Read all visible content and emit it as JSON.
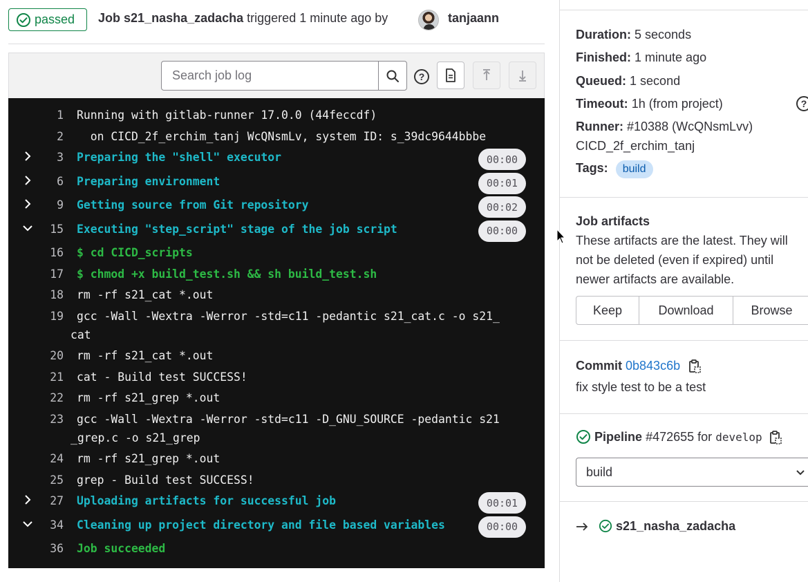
{
  "header": {
    "status_label": "passed",
    "job_prefix": "Job",
    "job_name": "s21_nasha_zadacha",
    "triggered_text": "triggered 1 minute ago by",
    "author": "tanjaann"
  },
  "toolbar": {
    "search_placeholder": "Search job log"
  },
  "log": {
    "lines": [
      {
        "n": "1",
        "text": "Running with gitlab-runner 17.0.0 (44feccdf)",
        "kind": "plain"
      },
      {
        "n": "2",
        "text": "  on CICD_2f_erchim_tanj WcQNsmLv, system ID: s_39dc9644bbbe",
        "kind": "plain"
      },
      {
        "n": "3",
        "text": "Preparing the \"shell\" executor",
        "kind": "section",
        "collapsed": true,
        "duration": "00:00"
      },
      {
        "n": "6",
        "text": "Preparing environment",
        "kind": "section",
        "collapsed": true,
        "duration": "00:01"
      },
      {
        "n": "9",
        "text": "Getting source from Git repository",
        "kind": "section",
        "collapsed": true,
        "duration": "00:02"
      },
      {
        "n": "15",
        "text": "Executing \"step_script\" stage of the job script",
        "kind": "section",
        "collapsed": false,
        "duration": "00:00"
      },
      {
        "n": "16",
        "text": "$ cd CICD_scripts",
        "kind": "command"
      },
      {
        "n": "17",
        "text": "$ chmod +x build_test.sh && sh build_test.sh",
        "kind": "command"
      },
      {
        "n": "18",
        "text": "rm -rf s21_cat *.out",
        "kind": "plain"
      },
      {
        "n": "19",
        "text": "gcc -Wall -Wextra -Werror -std=c11 -pedantic s21_cat.c -o s21_",
        "cont": "cat",
        "kind": "plain"
      },
      {
        "n": "20",
        "text": "rm -rf s21_cat *.out",
        "kind": "plain"
      },
      {
        "n": "21",
        "text": "cat - Build test SUCCESS!",
        "kind": "plain"
      },
      {
        "n": "22",
        "text": "rm -rf s21_grep *.out",
        "kind": "plain"
      },
      {
        "n": "23",
        "text": "gcc -Wall -Wextra -Werror -std=c11 -D_GNU_SOURCE -pedantic s21",
        "cont": "_grep.c -o s21_grep",
        "kind": "plain"
      },
      {
        "n": "24",
        "text": "rm -rf s21_grep *.out",
        "kind": "plain"
      },
      {
        "n": "25",
        "text": "grep - Build test SUCCESS!",
        "kind": "plain"
      },
      {
        "n": "27",
        "text": "Uploading artifacts for successful job",
        "kind": "section",
        "collapsed": true,
        "duration": "00:01"
      },
      {
        "n": "34",
        "text": "Cleaning up project directory and file based variables",
        "kind": "section",
        "collapsed": false,
        "duration": "00:00"
      },
      {
        "n": "36",
        "text": "Job succeeded",
        "kind": "success"
      }
    ]
  },
  "sidebar": {
    "duration_label": "Duration:",
    "duration_value": "5 seconds",
    "finished_label": "Finished:",
    "finished_value": "1 minute ago",
    "queued_label": "Queued:",
    "queued_value": "1 second",
    "timeout_label": "Timeout:",
    "timeout_value": "1h (from project)",
    "runner_label": "Runner:",
    "runner_value": "#10388 (WcQNsmLvv)",
    "runner_name": "CICD_2f_erchim_tanj",
    "tags_label": "Tags:",
    "tag": "build",
    "artifacts_title": "Job artifacts",
    "artifacts_desc": "These artifacts are the latest. They will not be deleted (even if expired) until newer artifacts are available.",
    "keep_label": "Keep",
    "download_label": "Download",
    "browse_label": "Browse",
    "commit_label": "Commit",
    "commit_sha": "0b843c6b",
    "commit_message": "fix style test to be a test",
    "pipeline_label": "Pipeline",
    "pipeline_id": "#472655",
    "pipeline_for": "for",
    "pipeline_branch": "develop",
    "stage_selected": "build",
    "job_link": "s21_nasha_zadacha"
  },
  "colors": {
    "success": "#108548",
    "log_bg": "#131313",
    "section": "#1ebac9",
    "command": "#2dba45",
    "link": "#1f75cb"
  }
}
